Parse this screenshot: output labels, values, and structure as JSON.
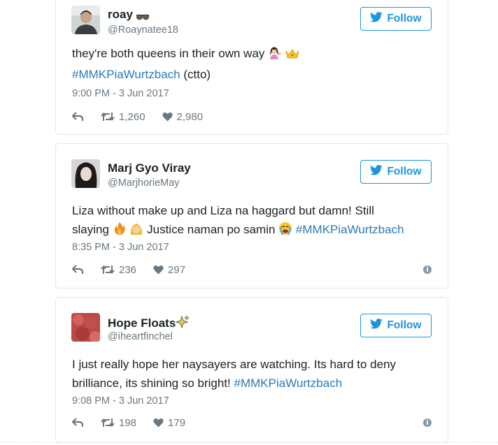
{
  "colors": {
    "accent": "#1b95e0",
    "hashtag": "#2b7bb9",
    "muted": "#697882"
  },
  "follow_label": "Follow",
  "tweets": [
    {
      "name": "roay",
      "handle": "@Roaynatee18",
      "text_before": "they're both queens in their own way",
      "hashtag": "#MMKPiaWurtzbach",
      "text_after": "(ctto)",
      "time": "9:00 PM - 3 Jun 2017",
      "retweets": "1,260",
      "likes": "2,980"
    },
    {
      "name": "Marj Gyo Viray",
      "handle": "@MarjhorieMay",
      "line1": "Liza without make up and Liza na haggard but damn! Still",
      "line2_a": "slaying",
      "line2_b": "Justice naman po samin",
      "hashtag": "#MMKPiaWurtzbach",
      "time": "8:35 PM - 3 Jun 2017",
      "retweets": "236",
      "likes": "297"
    },
    {
      "name": "Hope Floats",
      "handle": "@iheartfinchel",
      "line1": "I just really hope her naysayers are watching. Its hard to deny",
      "line2": "brilliance, its shining so bright!",
      "hashtag": "#MMKPiaWurtzbach",
      "time": "9:08 PM - 3 Jun 2017",
      "retweets": "198",
      "likes": "179"
    }
  ]
}
